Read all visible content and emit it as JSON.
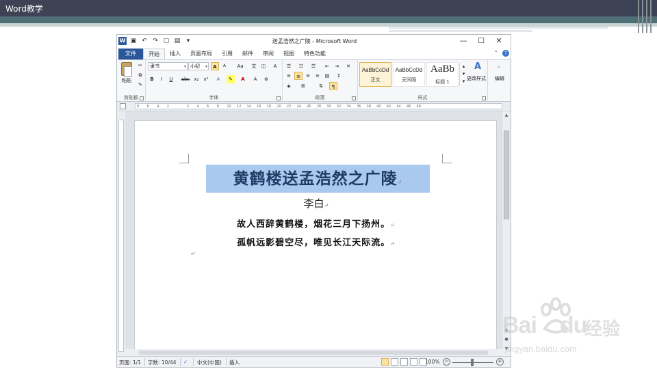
{
  "slide": {
    "title": "Word教学"
  },
  "window": {
    "title": "送孟浩然之广陵 - Microsoft Word",
    "controls": {
      "minimize": "—",
      "maximize": "☐",
      "close": "✕"
    }
  },
  "tabs": [
    {
      "label": "文件"
    },
    {
      "label": "开始"
    },
    {
      "label": "插入"
    },
    {
      "label": "页面布局"
    },
    {
      "label": "引用"
    },
    {
      "label": "邮件"
    },
    {
      "label": "审阅"
    },
    {
      "label": "视图"
    },
    {
      "label": "特色功能"
    }
  ],
  "ribbon": {
    "clipboard": {
      "label": "剪贴板",
      "paste": "粘贴"
    },
    "font": {
      "label": "字体",
      "font_name": "隶书",
      "font_size": "小初",
      "grow": "A",
      "shrink": "A",
      "aa": "Aa",
      "bold": "B",
      "italic": "I",
      "underline": "U",
      "strike": "abc",
      "subscript": "x₂",
      "superscript": "x²"
    },
    "paragraph": {
      "label": "段落"
    },
    "styles": {
      "label": "样式",
      "items": [
        {
          "sample": "AaBbCcDd",
          "name": "正文"
        },
        {
          "sample": "AaBbCcDd",
          "name": "无间隔"
        },
        {
          "sample": "AaBb",
          "name": "标题 1"
        }
      ],
      "change_styles": "更改样式"
    },
    "editing": {
      "label": "编辑"
    }
  },
  "ruler": {
    "marks": [
      "8",
      "6",
      "4",
      "2",
      "",
      "2",
      "4",
      "6",
      "8",
      "10",
      "12",
      "14",
      "16",
      "18",
      "20",
      "22",
      "24",
      "26",
      "28",
      "30",
      "32",
      "34",
      "36",
      "38",
      "40",
      "42",
      "44",
      "46",
      "48"
    ]
  },
  "document": {
    "title": "黄鹤楼送孟浩然之广陵",
    "author": "李白",
    "lines": [
      "故人西辞黄鹤楼，烟花三月下扬州。",
      "孤帆远影碧空尽，唯见长江天际流。"
    ],
    "para_mark": "↵"
  },
  "status": {
    "page": "页面: 1/1",
    "words": "字数: 10/44",
    "language": "中文(中国)",
    "mode": "插入",
    "zoom": "100%"
  },
  "watermark": {
    "brand": "Bai",
    "brand2": "du",
    "cn": "经验",
    "url": "jingyan.baidu.com"
  },
  "colors": {
    "accent": "#2b579a",
    "highlight": "#a9c9ee",
    "header": "#3d4354",
    "teal": "#4e6f75"
  }
}
